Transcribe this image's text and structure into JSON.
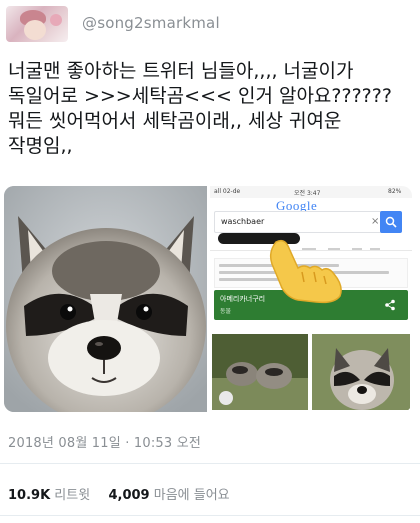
{
  "header": {
    "username": "@song2smarkmal",
    "avatar_icon": "profile-avatar"
  },
  "tweet": {
    "lines": [
      "너굴맨 좋아하는 트위터 님들아,,,, 너굴이가",
      "독일어로 >>>세탁곰<<< 인거 알아요??????",
      "뭐든 씻어먹어서 세탁곰이래,, 세상 귀여운",
      "작명임,,"
    ]
  },
  "media": {
    "phone": {
      "status_left": "all 02-de",
      "status_time": "오전 3:47",
      "status_right": "82%",
      "google_logo": "Google",
      "search_query": "waschbaer",
      "clear_symbol": "×",
      "result_title": "아메리카너구리",
      "result_subtitle": "동물"
    },
    "overlay_icon": "pointing-hand-emoji"
  },
  "meta": {
    "timestamp": "2018년 08월 11일 · 10:53 오전"
  },
  "stats": {
    "retweets_count": "10.9K",
    "retweets_label": "리트윗",
    "likes_count": "4,009",
    "likes_label": "마음에 들어요"
  },
  "colors": {
    "text": "#14171a",
    "muted": "#8a8f94",
    "google_blue": "#4285f4",
    "knowledge_green": "#2e7d32",
    "finger_yellow": "#f5c84a"
  }
}
